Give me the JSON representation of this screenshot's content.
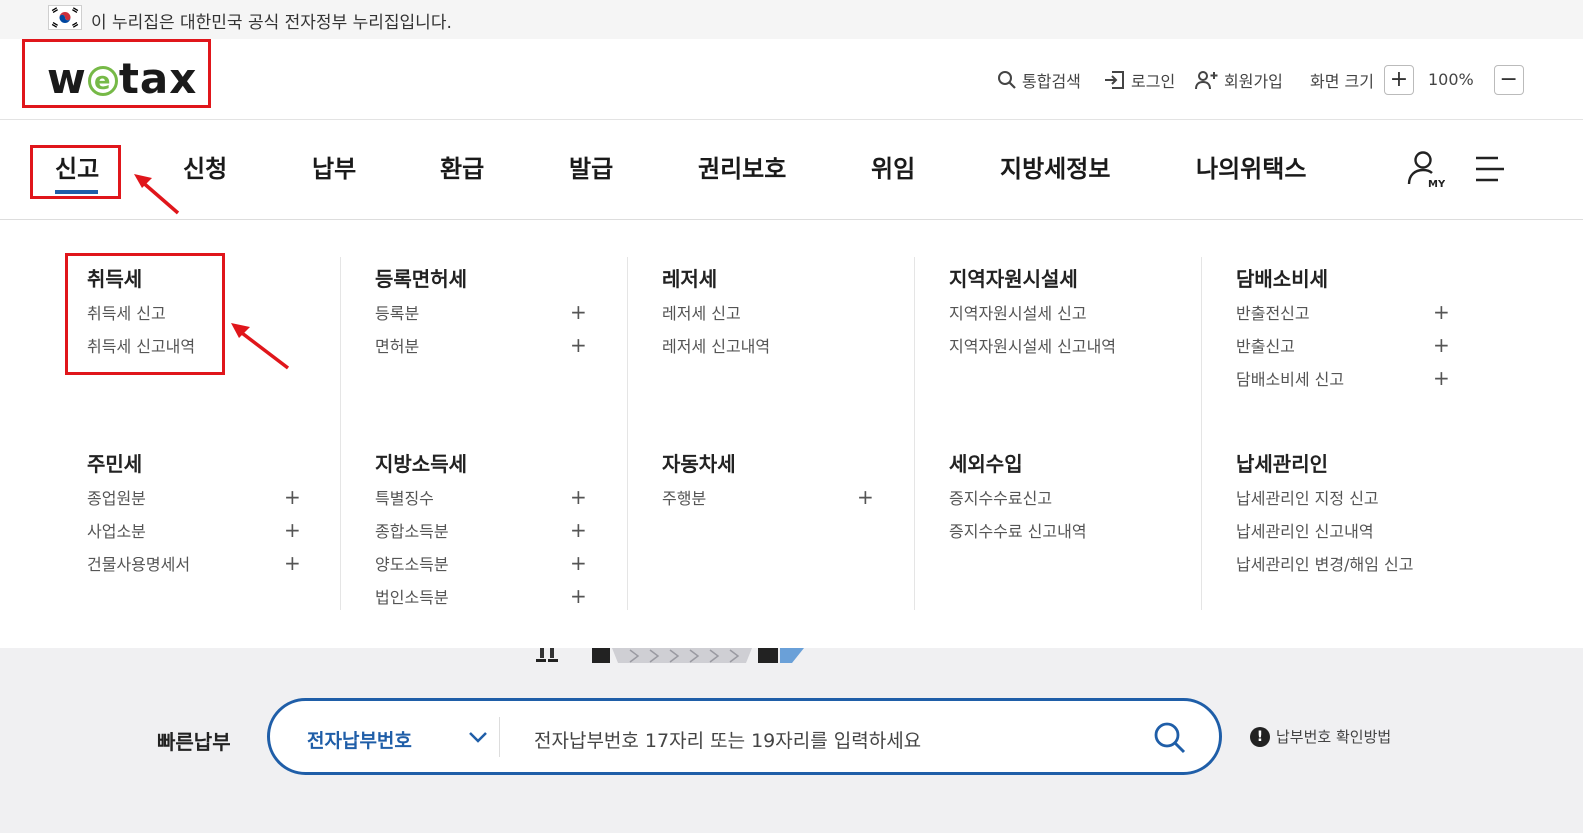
{
  "gov_banner": {
    "text": "이 누리집은 대한민국 공식 전자정부 누리집입니다."
  },
  "logo": {
    "before": "w",
    "e": "e",
    "after": "tax"
  },
  "utility": {
    "search": "통합검색",
    "login": "로그인",
    "signup": "회원가입",
    "screen_size": "화면 크기",
    "zoom_in": "+",
    "zoom": "100%",
    "zoom_out": "−"
  },
  "nav": [
    {
      "label": "신고",
      "active": true
    },
    {
      "label": "신청"
    },
    {
      "label": "납부"
    },
    {
      "label": "환급"
    },
    {
      "label": "발급"
    },
    {
      "label": "권리보호"
    },
    {
      "label": "위임"
    },
    {
      "label": "지방세정보"
    },
    {
      "label": "나의위택스"
    }
  ],
  "my_label": "MY",
  "groups": [
    {
      "title": "취득세",
      "items": [
        {
          "label": "취득세 신고"
        },
        {
          "label": "취득세 신고내역"
        }
      ]
    },
    {
      "title": "등록면허세",
      "items": [
        {
          "label": "등록분",
          "plus": "+"
        },
        {
          "label": "면허분",
          "plus": "+"
        }
      ]
    },
    {
      "title": "레저세",
      "items": [
        {
          "label": "레저세 신고"
        },
        {
          "label": "레저세 신고내역"
        }
      ]
    },
    {
      "title": "지역자원시설세",
      "items": [
        {
          "label": "지역자원시설세 신고"
        },
        {
          "label": "지역자원시설세 신고내역"
        }
      ]
    },
    {
      "title": "담배소비세",
      "items": [
        {
          "label": "반출전신고",
          "plus": "+"
        },
        {
          "label": "반출신고",
          "plus": "+"
        },
        {
          "label": "담배소비세 신고",
          "plus": "+"
        }
      ]
    },
    {
      "title": "주민세",
      "items": [
        {
          "label": "종업원분",
          "plus": "+"
        },
        {
          "label": "사업소분",
          "plus": "+"
        },
        {
          "label": "건물사용명세서",
          "plus": "+"
        }
      ]
    },
    {
      "title": "지방소득세",
      "items": [
        {
          "label": "특별징수",
          "plus": "+"
        },
        {
          "label": "종합소득분",
          "plus": "+"
        },
        {
          "label": "양도소득분",
          "plus": "+"
        },
        {
          "label": "법인소득분",
          "plus": "+"
        }
      ]
    },
    {
      "title": "자동차세",
      "items": [
        {
          "label": "주행분",
          "plus": "+"
        }
      ]
    },
    {
      "title": "세외수입",
      "items": [
        {
          "label": "증지수수료신고"
        },
        {
          "label": "증지수수료 신고내역"
        }
      ]
    },
    {
      "title": "납세관리인",
      "items": [
        {
          "label": "납세관리인 지정 신고"
        },
        {
          "label": "납세관리인 신고내역"
        },
        {
          "label": "납세관리인 변경/해임 신고"
        }
      ]
    }
  ],
  "quick_pay": {
    "label": "빠른납부",
    "select_value": "전자납부번호",
    "placeholder": "전자납부번호 17자리 또는 19자리를 입력하세요",
    "info_mark": "!",
    "info_text": "납부번호 확인방법"
  },
  "colors": {
    "brand_blue": "#1f5ea8",
    "logo_green": "#76b947",
    "annotation_red": "#e0161b"
  }
}
